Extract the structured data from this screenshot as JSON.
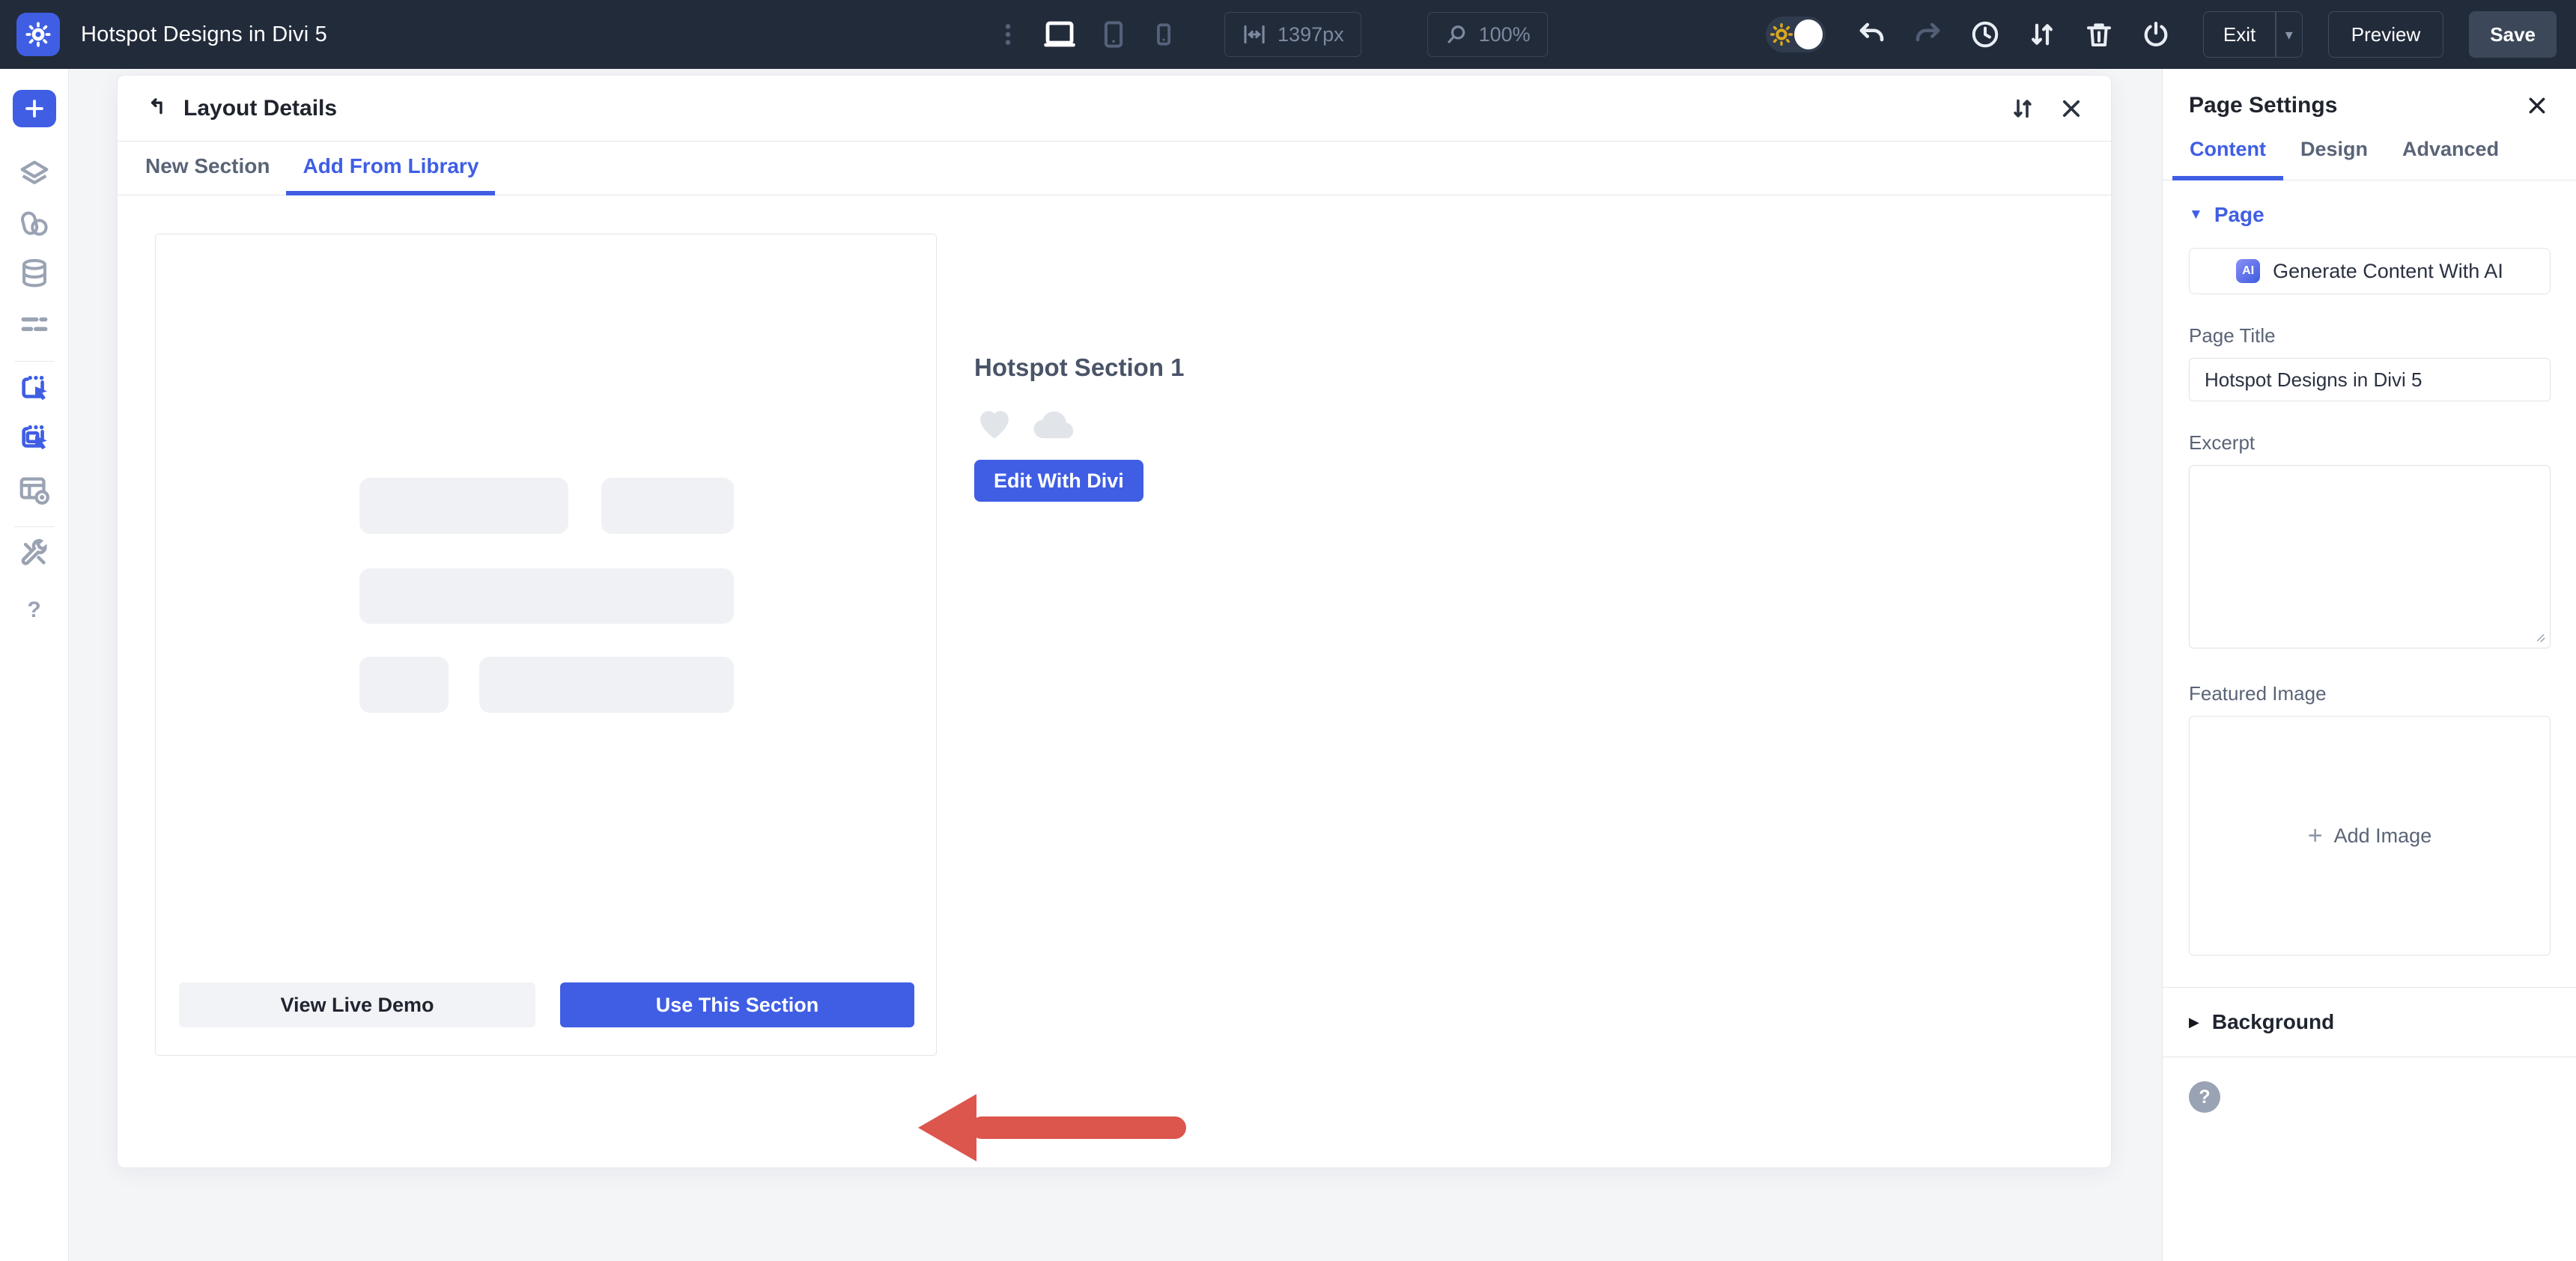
{
  "topbar": {
    "title": "Hotspot Designs in Divi 5",
    "width_value": "1397px",
    "zoom_value": "100%",
    "exit_label": "Exit",
    "preview_label": "Preview",
    "save_label": "Save"
  },
  "modal": {
    "title": "Layout Details",
    "tabs": [
      "New Section",
      "Add From Library"
    ],
    "active_tab": "Add From Library",
    "section_name": "Hotspot Section 1",
    "edit_button": "Edit With Divi",
    "view_demo_button": "View Live Demo",
    "use_section_button": "Use This Section"
  },
  "page_settings": {
    "title": "Page Settings",
    "tabs": [
      "Content",
      "Design",
      "Advanced"
    ],
    "active_tab": "Content",
    "page_group_label": "Page",
    "ai_button_label": "Generate Content With AI",
    "page_title_label": "Page Title",
    "page_title_value": "Hotspot Designs in Divi 5",
    "excerpt_label": "Excerpt",
    "excerpt_value": "",
    "featured_image_label": "Featured Image",
    "add_image_label": "Add Image",
    "background_label": "Background"
  },
  "icons": {
    "ai_badge": "AI",
    "exit_caret": "▾",
    "page_caret": "▼",
    "background_caret": "▶",
    "add_plus": "+",
    "help_glyph": "?"
  },
  "colors": {
    "topbar_bg": "#222B3A",
    "accent_blue": "#3F5EE4",
    "save_button_bg": "#3C4859",
    "red_arrow": "#DC564E",
    "canvas_bg": "#F4F5F7"
  }
}
